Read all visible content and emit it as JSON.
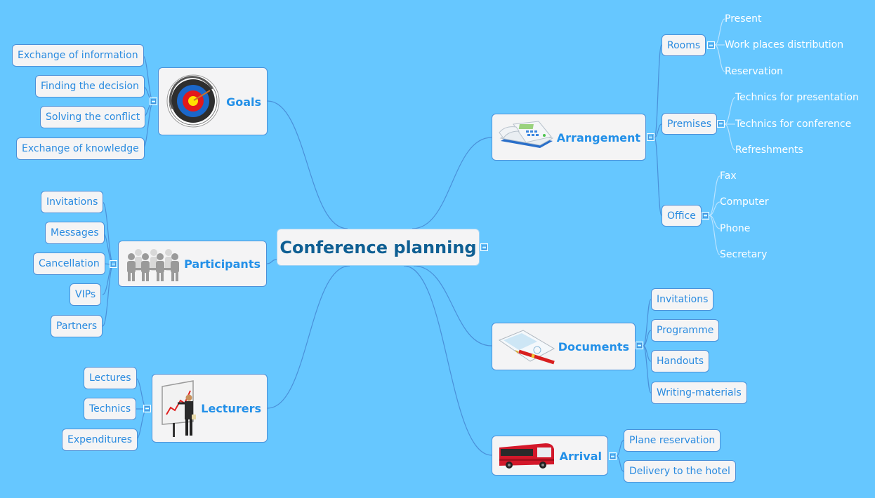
{
  "root": {
    "label": "Conference planning"
  },
  "colors": {
    "background": "#66c7ff",
    "node_fill": "#f4f4f5",
    "node_text": "#2a8be0",
    "root_text": "#0f5f93",
    "connector": "#4a90d9",
    "sub_connector": "#b9e3ff",
    "plain_text": "#ffffff"
  },
  "branches": {
    "goals": {
      "label": "Goals",
      "icon": "target-icon",
      "children": [
        "Exchange of information",
        "Finding the decision",
        "Solving the conflict",
        "Exchange of knowledge"
      ]
    },
    "participants": {
      "label": "Participants",
      "icon": "people-icon",
      "children": [
        "Invitations",
        "Messages",
        "Cancellation",
        "VIPs",
        "Partners"
      ]
    },
    "lecturers": {
      "label": "Lecturers",
      "icon": "presenter-icon",
      "children": [
        "Lectures",
        "Technics",
        "Expenditures"
      ]
    },
    "arrangement": {
      "label": "Arrangement",
      "icon": "telephone-icon",
      "children": [
        {
          "label": "Rooms",
          "children": [
            "Present",
            "Work places distribution",
            "Reservation"
          ]
        },
        {
          "label": "Premises",
          "children": [
            "Technics for presentation",
            "Technics for conference",
            "Refreshments"
          ]
        },
        {
          "label": "Office",
          "children": [
            "Fax",
            "Computer",
            "Phone",
            "Secretary"
          ]
        }
      ]
    },
    "documents": {
      "label": "Documents",
      "icon": "document-pen-icon",
      "children": [
        "Invitations",
        "Programme",
        "Handouts",
        "Writing-materials"
      ]
    },
    "arrival": {
      "label": "Arrival",
      "icon": "bus-icon",
      "children": [
        "Plane reservation",
        "Delivery to the hotel"
      ]
    }
  }
}
